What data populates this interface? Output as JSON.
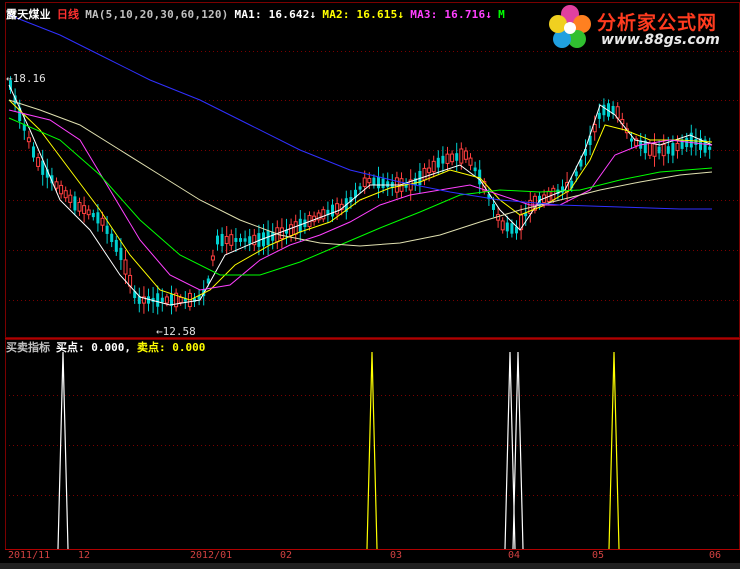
{
  "header": {
    "stock_name": "露天煤业",
    "period": "日线",
    "ma_label": "MA(5,10,20,30,60,120)",
    "ma1": "MA1: 16.642↓",
    "ma2": "MA2: 16.615↓",
    "ma3": "MA3: 16.716↓",
    "ma4": "M"
  },
  "price_labels": {
    "high": "←18.16",
    "low": "←12.58"
  },
  "indicator": {
    "name": "买卖指标",
    "buy": "买点: 0.000,",
    "sell": "卖点: 0.000"
  },
  "time_axis": [
    "2011/11",
    "12",
    "2012/01",
    "02",
    "03",
    "04",
    "05",
    "06"
  ],
  "logo": {
    "title": "分析家公式网",
    "url": "www.88gs.com"
  },
  "colors": {
    "up": "#ff4040",
    "down": "#00d0d0",
    "ma1": "#ffffff",
    "ma2": "#ffff00",
    "ma3": "#ff40ff",
    "ma4": "#00ff00",
    "ma5": "#e0e0b0",
    "ma6": "#3030ff",
    "grid": "#8b0000"
  }
}
